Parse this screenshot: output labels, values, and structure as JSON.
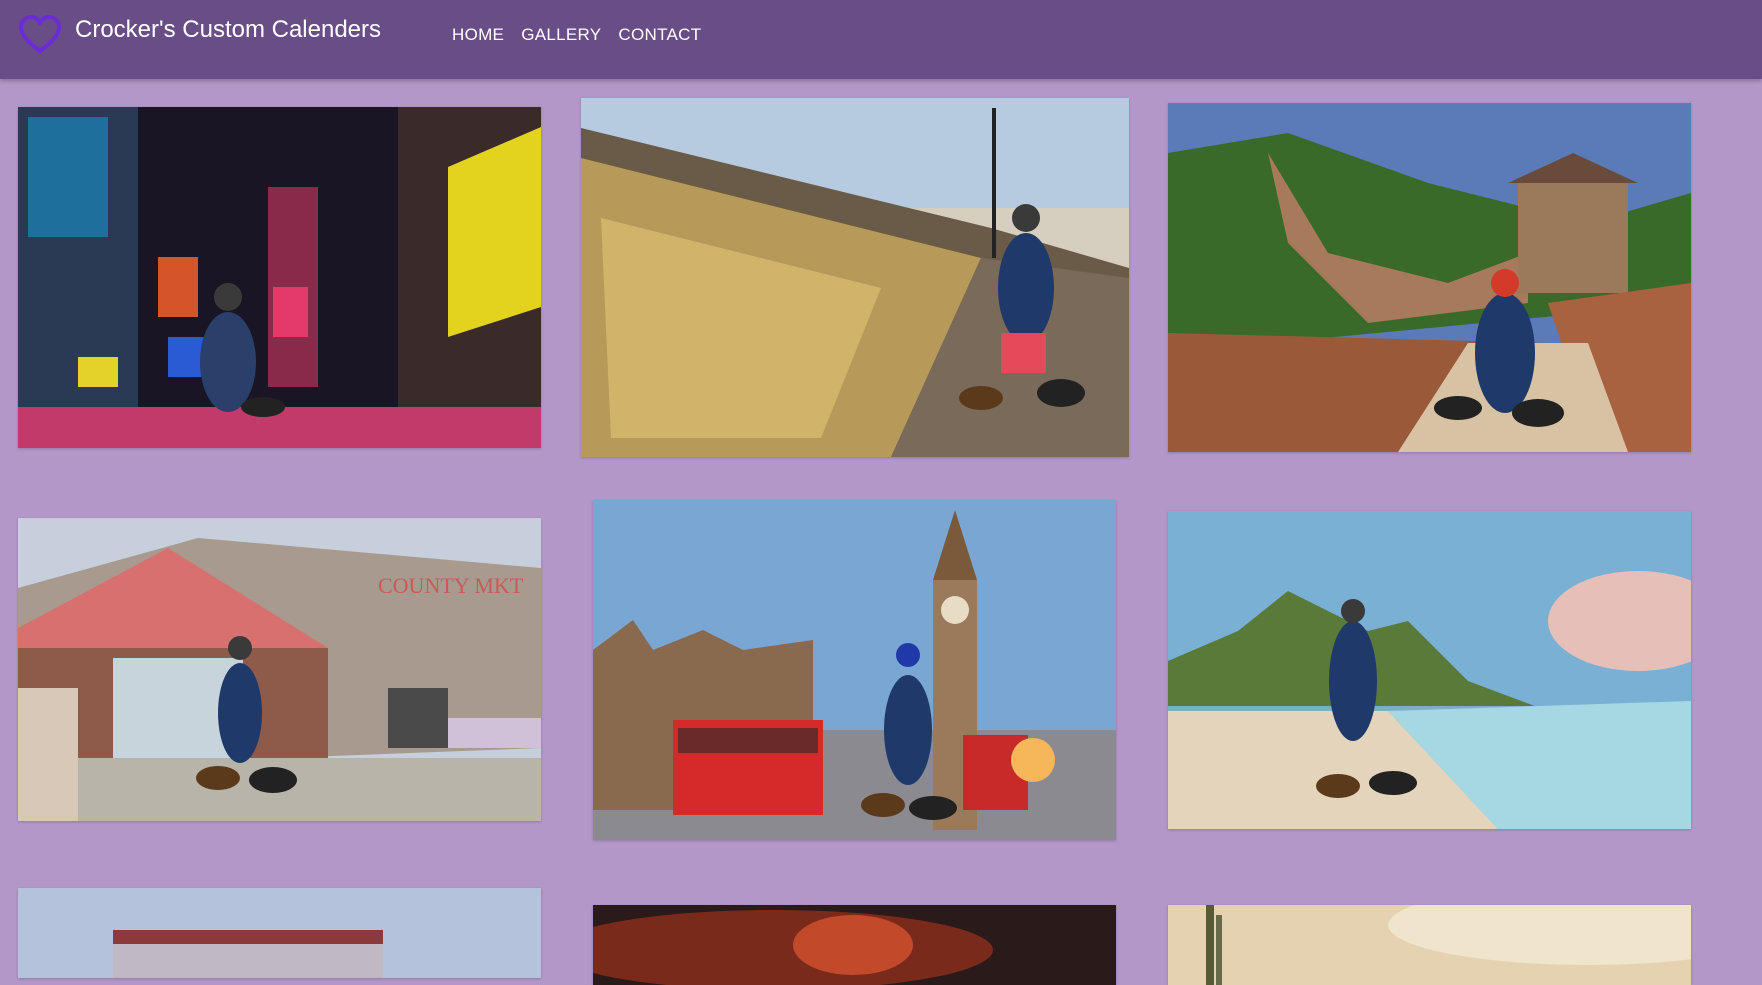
{
  "header": {
    "logo_icon": "heart-outline-icon",
    "site_title": "Crocker's Custom Calenders",
    "nav": [
      {
        "label": "HOME"
      },
      {
        "label": "GALLERY"
      },
      {
        "label": "CONTACT"
      }
    ]
  },
  "colors": {
    "header_bg": "#694d87",
    "page_bg": "#b497c9",
    "logo": "#6a2bd8",
    "nav_text": "#ffffff"
  },
  "gallery": {
    "photos": [
      {
        "scene": "times-square-new-years"
      },
      {
        "scene": "paris-love-lock-bridge"
      },
      {
        "scene": "great-wall-of-china"
      },
      {
        "scene": "county-market-storefront"
      },
      {
        "scene": "london-big-ben-red-buses"
      },
      {
        "scene": "tropical-beach-mountains"
      },
      {
        "scene": "red-roof-structure"
      },
      {
        "scene": "fireworks-night"
      },
      {
        "scene": "desert-cactus"
      }
    ]
  }
}
